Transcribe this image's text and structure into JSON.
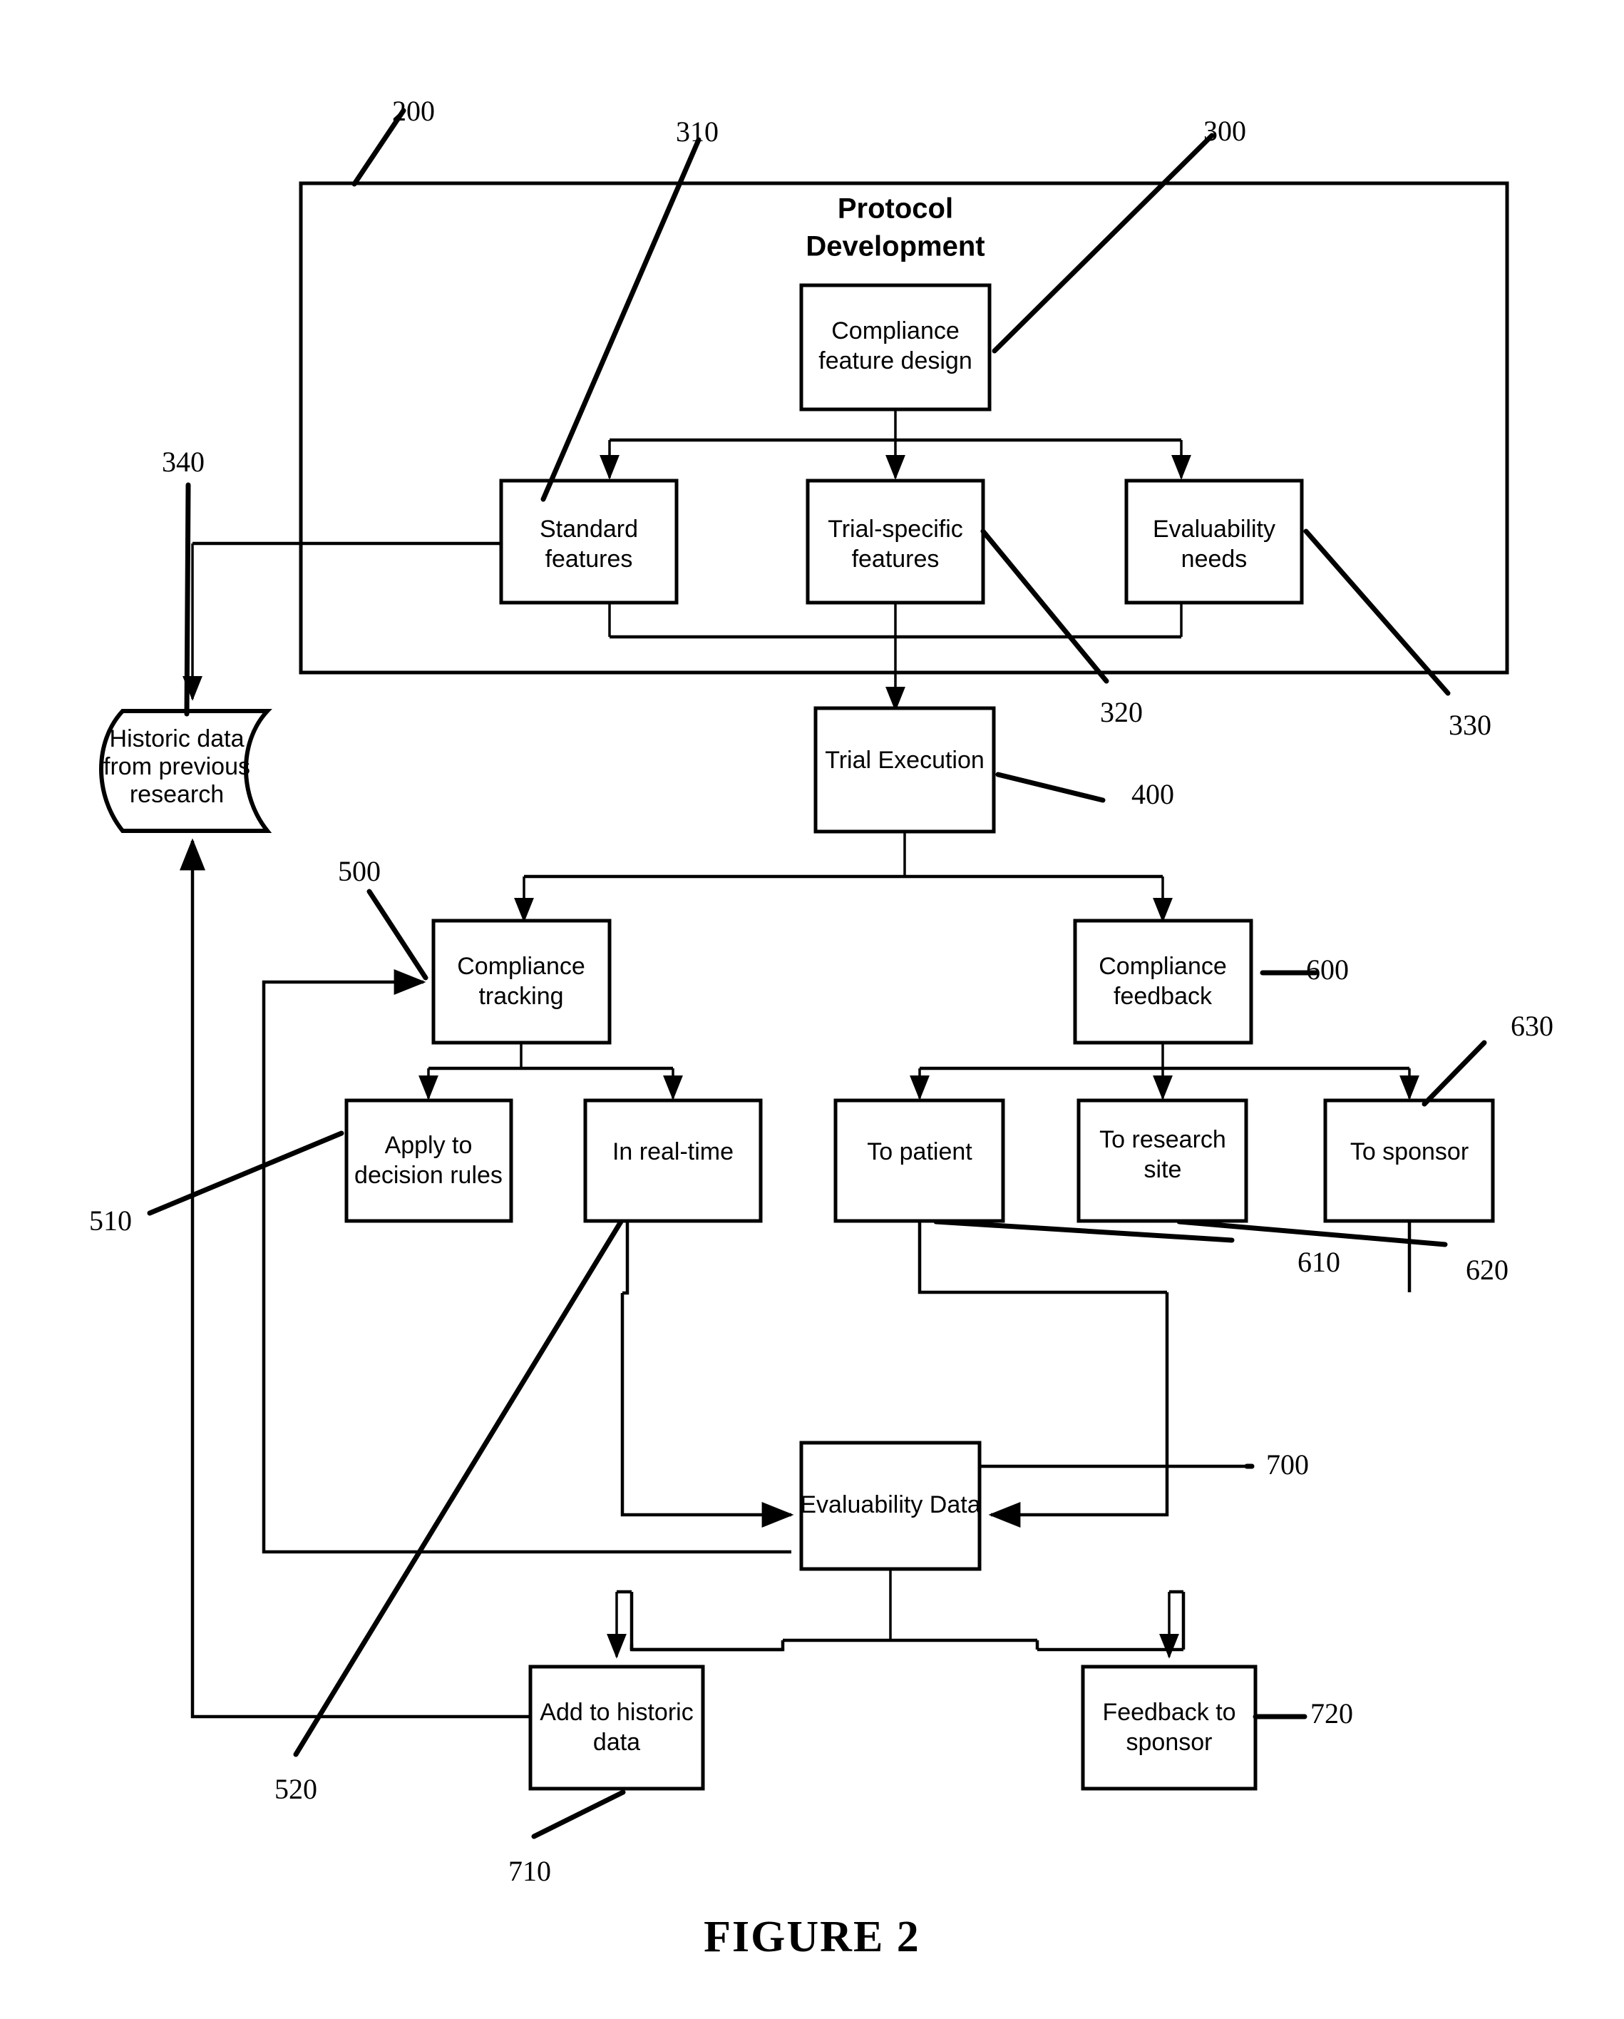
{
  "figure": {
    "caption": "FIGURE 2"
  },
  "container": {
    "title_line1": "Protocol",
    "title_line2": "Development",
    "ref": "200"
  },
  "nodes": {
    "compliance_feature_design": {
      "line1": "Compliance",
      "line2": "feature design",
      "ref": "300"
    },
    "standard_features": {
      "line1": "Standard",
      "line2": "features",
      "ref": "310"
    },
    "trial_specific_features": {
      "line1": "Trial-specific",
      "line2": "features",
      "ref": "320"
    },
    "evaluability_needs": {
      "line1": "Evaluability",
      "line2": "needs",
      "ref": "330"
    },
    "historic_data": {
      "line1": "Historic data",
      "line2": "from previous",
      "line3": "research",
      "ref": "340"
    },
    "trial_execution": {
      "line1": "Trial Execution",
      "ref": "400"
    },
    "compliance_tracking": {
      "line1": "Compliance",
      "line2": "tracking",
      "ref": "500"
    },
    "apply_decision_rules": {
      "line1": "Apply to",
      "line2": "decision rules",
      "ref": "510"
    },
    "in_real_time": {
      "line1": "In real-time",
      "ref": "520"
    },
    "compliance_feedback": {
      "line1": "Compliance",
      "line2": "feedback",
      "ref": "600"
    },
    "to_patient": {
      "line1": "To patient",
      "ref": "610"
    },
    "to_research_site": {
      "line1": "To research",
      "line2": "site",
      "ref": "620"
    },
    "to_sponsor": {
      "line1": "To sponsor",
      "ref": "630"
    },
    "evaluability_data": {
      "line1": "Evaluability Data",
      "ref": "700"
    },
    "add_to_historic_data": {
      "line1": "Add to historic",
      "line2": "data",
      "ref": "710"
    },
    "feedback_to_sponsor": {
      "line1": "Feedback to",
      "line2": "sponsor",
      "ref": "720"
    }
  },
  "chart_data": {
    "type": "diagram",
    "title": "FIGURE 2",
    "diagram_kind": "patent-flowchart",
    "nodes": [
      {
        "id": "200",
        "label": "Protocol Development",
        "shape": "container"
      },
      {
        "id": "300",
        "label": "Compliance feature design",
        "shape": "rect"
      },
      {
        "id": "310",
        "label": "Standard features",
        "shape": "rect"
      },
      {
        "id": "320",
        "label": "Trial-specific features",
        "shape": "rect"
      },
      {
        "id": "330",
        "label": "Evaluability needs",
        "shape": "rect"
      },
      {
        "id": "340",
        "label": "Historic data from previous research",
        "shape": "database"
      },
      {
        "id": "400",
        "label": "Trial Execution",
        "shape": "rect"
      },
      {
        "id": "500",
        "label": "Compliance tracking",
        "shape": "rect"
      },
      {
        "id": "510",
        "label": "Apply to decision rules",
        "shape": "rect"
      },
      {
        "id": "520",
        "label": "In real-time",
        "shape": "rect"
      },
      {
        "id": "600",
        "label": "Compliance feedback",
        "shape": "rect"
      },
      {
        "id": "610",
        "label": "To patient",
        "shape": "rect"
      },
      {
        "id": "620",
        "label": "To research site",
        "shape": "rect"
      },
      {
        "id": "630",
        "label": "To sponsor",
        "shape": "rect"
      },
      {
        "id": "700",
        "label": "Evaluability Data",
        "shape": "rect"
      },
      {
        "id": "710",
        "label": "Add to historic data",
        "shape": "rect"
      },
      {
        "id": "720",
        "label": "Feedback to sponsor",
        "shape": "rect"
      }
    ],
    "edges": [
      {
        "from": "300",
        "to": "310"
      },
      {
        "from": "300",
        "to": "320"
      },
      {
        "from": "300",
        "to": "330"
      },
      {
        "from": "340",
        "to": "310"
      },
      {
        "from": "310",
        "to": "400"
      },
      {
        "from": "320",
        "to": "400"
      },
      {
        "from": "330",
        "to": "400"
      },
      {
        "from": "400",
        "to": "500"
      },
      {
        "from": "400",
        "to": "600"
      },
      {
        "from": "500",
        "to": "510"
      },
      {
        "from": "500",
        "to": "520"
      },
      {
        "from": "600",
        "to": "610"
      },
      {
        "from": "600",
        "to": "620"
      },
      {
        "from": "600",
        "to": "630"
      },
      {
        "from": "520",
        "to": "700"
      },
      {
        "from": "610",
        "to": "700"
      },
      {
        "from": "630",
        "to": "700"
      },
      {
        "from": "700",
        "to": "710"
      },
      {
        "from": "700",
        "to": "720"
      },
      {
        "from": "710",
        "to": "340"
      },
      {
        "from": "700",
        "to": "500"
      }
    ]
  }
}
